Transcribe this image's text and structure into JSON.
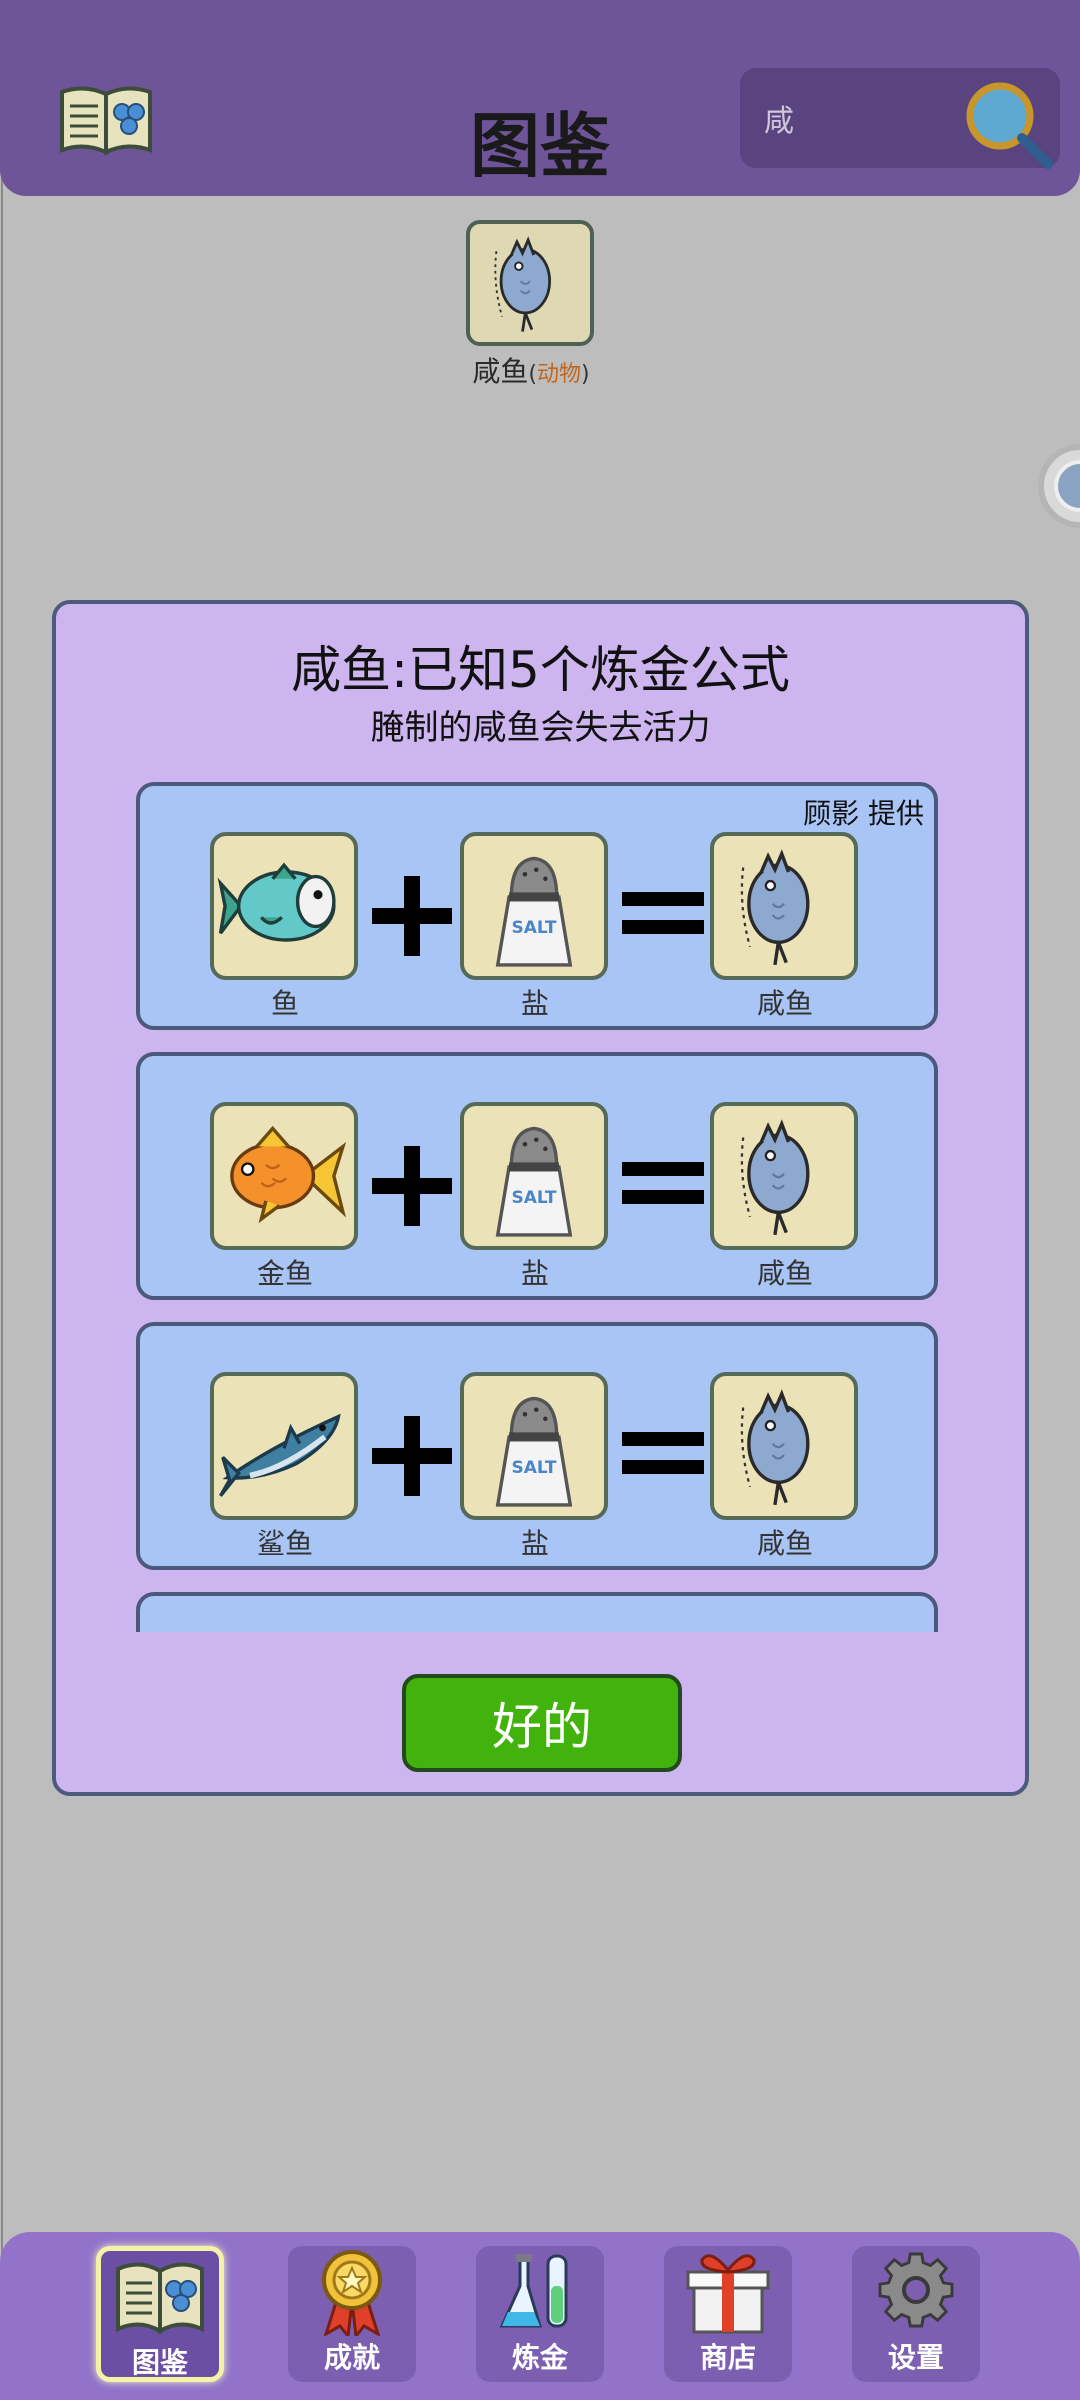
{
  "header": {
    "title": "图鉴",
    "search_value": "咸"
  },
  "result": {
    "name": "咸鱼",
    "paren_open": "(",
    "category": "动物",
    "paren_close": ")"
  },
  "dialog": {
    "title": "咸鱼:已知5个炼金公式",
    "description": "腌制的咸鱼会失去活力",
    "formulas": [
      {
        "credit": "顾影 提供",
        "a": "鱼",
        "b": "盐",
        "result": "咸鱼"
      },
      {
        "credit": "",
        "a": "金鱼",
        "b": "盐",
        "result": "咸鱼"
      },
      {
        "credit": "",
        "a": "鲨鱼",
        "b": "盐",
        "result": "咸鱼"
      }
    ],
    "ok_label": "好的"
  },
  "nav": {
    "items": [
      {
        "label": "图鉴",
        "icon": "book-icon",
        "active": true
      },
      {
        "label": "成就",
        "icon": "medal-icon",
        "active": false
      },
      {
        "label": "炼金",
        "icon": "flask-icon",
        "active": false
      },
      {
        "label": "商店",
        "icon": "gift-icon",
        "active": false
      },
      {
        "label": "设置",
        "icon": "gear-icon",
        "active": false
      }
    ]
  },
  "colors": {
    "header_bg": "#6e5499",
    "dialog_bg": "#cdb6f0",
    "card_bg": "#a9c5f6",
    "ok_button": "#42b20c",
    "nav_bg": "#9273c9"
  }
}
